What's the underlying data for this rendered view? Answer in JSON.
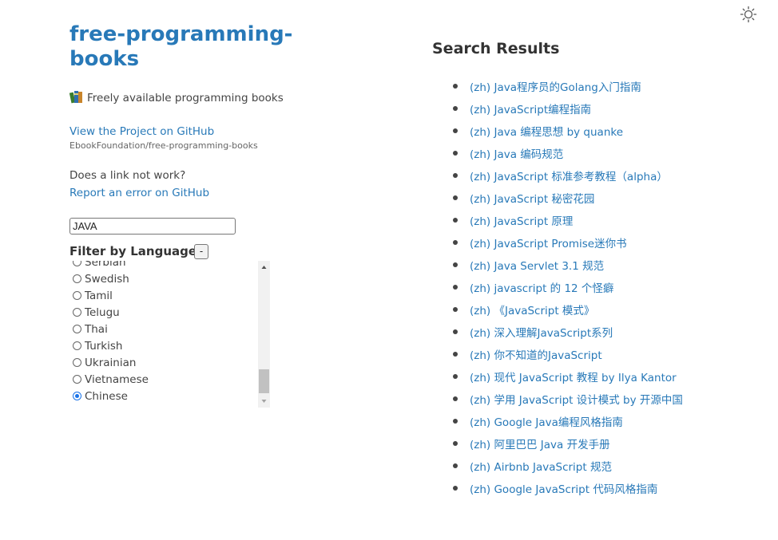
{
  "icons": {
    "theme": "sun-icon",
    "book": "books-icon"
  },
  "colors": {
    "link": "#2879b8",
    "text": "#444444",
    "radio_checked": "#1a73e8"
  },
  "sidebar": {
    "title": "free-programming-books",
    "tagline": "Freely available programming books",
    "github_link": "View the Project on GitHub",
    "github_repo": "EbookFoundation/free-programming-books",
    "question": "Does a link not work?",
    "report_link": "Report an error on GitHub",
    "search_value": "JAVA",
    "filter_heading": "Filter by Language",
    "collapse_label": "-",
    "languages": [
      {
        "label": "Serbian",
        "checked": false
      },
      {
        "label": "Swedish",
        "checked": false
      },
      {
        "label": "Tamil",
        "checked": false
      },
      {
        "label": "Telugu",
        "checked": false
      },
      {
        "label": "Thai",
        "checked": false
      },
      {
        "label": "Turkish",
        "checked": false
      },
      {
        "label": "Ukrainian",
        "checked": false
      },
      {
        "label": "Vietnamese",
        "checked": false
      },
      {
        "label": "Chinese",
        "checked": true
      }
    ]
  },
  "results": {
    "title": "Search Results",
    "items": [
      "(zh) Java程序员的Golang入门指南",
      "(zh) JavaScript编程指南",
      "(zh) Java 编程思想 by quanke",
      "(zh) Java 编码规范",
      "(zh) JavaScript 标准参考教程（alpha）",
      "(zh) JavaScript 秘密花园",
      "(zh) JavaScript 原理",
      "(zh) JavaScript Promise迷你书",
      "(zh) Java Servlet 3.1 规范",
      "(zh) javascript 的 12 个怪癖",
      "(zh) 《JavaScript 模式》",
      "(zh) 深入理解JavaScript系列",
      "(zh) 你不知道的JavaScript",
      "(zh) 现代 JavaScript 教程 by Ilya Kantor",
      "(zh) 学用 JavaScript 设计模式 by 开源中国",
      "(zh) Google Java编程风格指南",
      "(zh) 阿里巴巴 Java 开发手册",
      "(zh) Airbnb JavaScript 规范",
      "(zh) Google JavaScript 代码风格指南"
    ]
  }
}
